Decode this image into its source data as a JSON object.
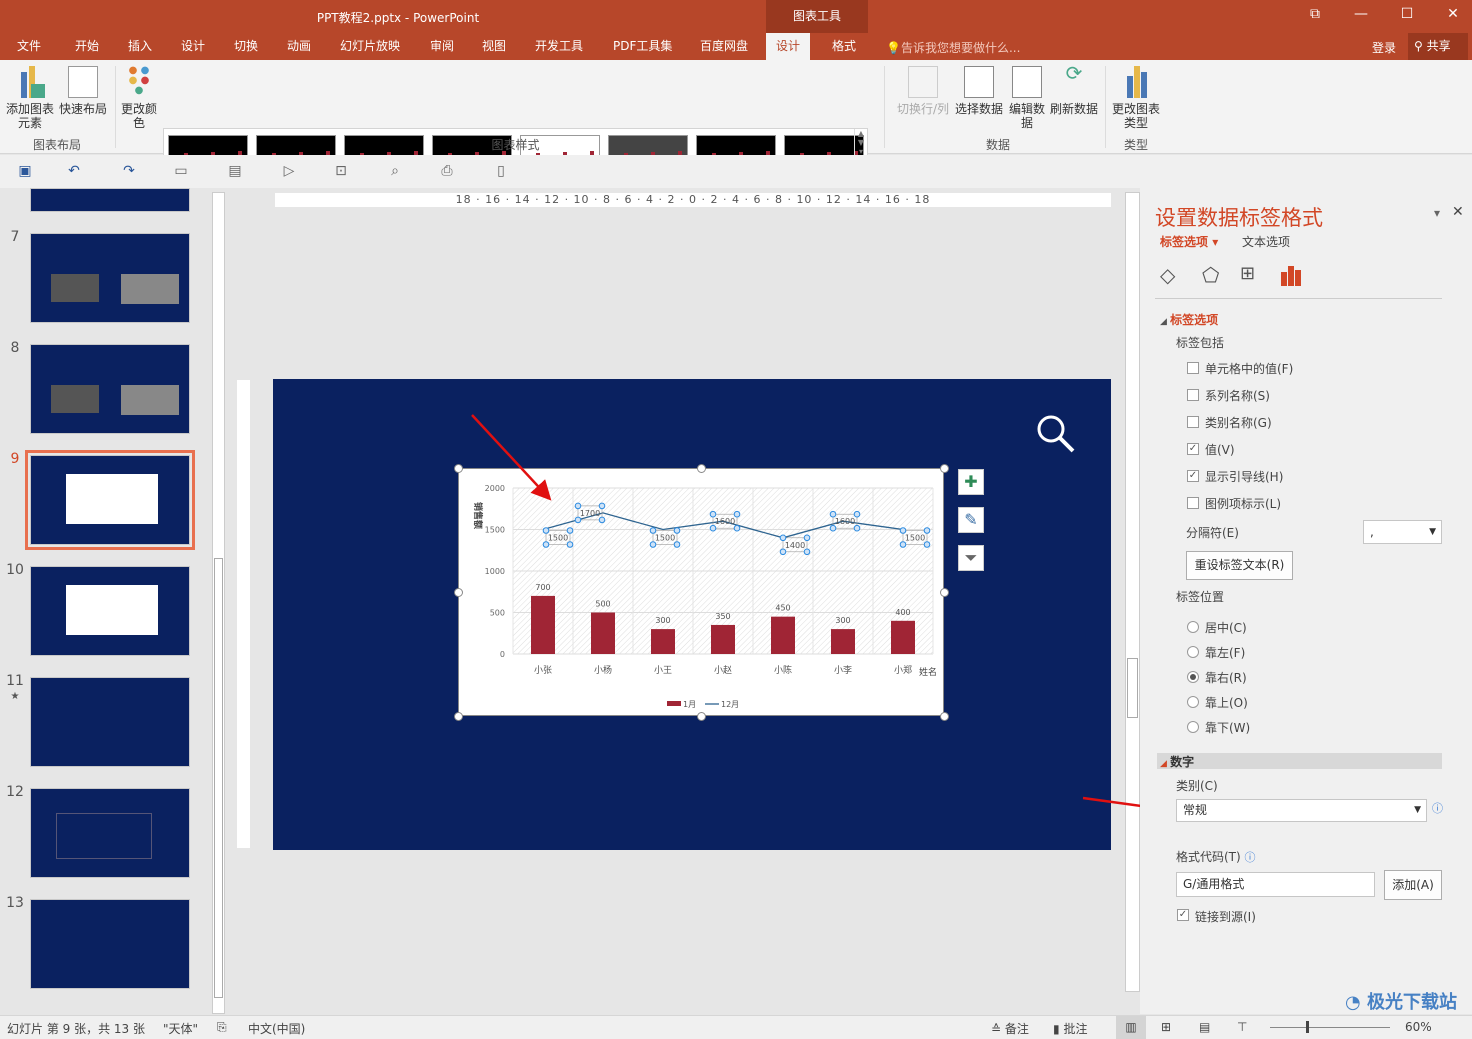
{
  "window": {
    "title": "PPT教程2.pptx - PowerPoint",
    "context_tab": "图表工具",
    "restore": "⧉",
    "minimize": "—",
    "maximize": "☐",
    "close": "✕"
  },
  "tabs": [
    {
      "label": "文件"
    },
    {
      "label": "开始"
    },
    {
      "label": "插入"
    },
    {
      "label": "设计"
    },
    {
      "label": "切换"
    },
    {
      "label": "动画"
    },
    {
      "label": "幻灯片放映"
    },
    {
      "label": "审阅"
    },
    {
      "label": "视图"
    },
    {
      "label": "开发工具"
    },
    {
      "label": "PDF工具集"
    },
    {
      "label": "百度网盘"
    },
    {
      "label": "设计",
      "active": true
    },
    {
      "label": "格式"
    }
  ],
  "tell_me": "告诉我您想要做什么...",
  "login": "登录",
  "share": "共享",
  "ribbon": {
    "add_element": "添加图表元素",
    "quick_layout": "快速布局",
    "change_color": "更改颜色",
    "switch_row_col": "切换行/列",
    "select_data": "选择数据",
    "edit_data": "编辑数据",
    "refresh_data": "刷新数据",
    "change_type": "更改图表类型",
    "groups": {
      "layout": "图表布局",
      "styles": "图表样式",
      "data": "数据",
      "type": "类型"
    }
  },
  "slides": [
    {
      "num": "7"
    },
    {
      "num": "8"
    },
    {
      "num": "9",
      "selected": true
    },
    {
      "num": "10"
    },
    {
      "num": "11",
      "star": "★"
    },
    {
      "num": "12"
    },
    {
      "num": "13"
    }
  ],
  "ruler": {
    "h": "18 · 16 · 14 · 12 · 10 · 8 · 6 · 4 · 2 · 0 · 2 · 4 · 6 · 8 · 10 · 12 · 14 · 16 · 18"
  },
  "chart_data": {
    "type": "bar+line",
    "categories": [
      "小张",
      "小杨",
      "小王",
      "小赵",
      "小陈",
      "小李",
      "小郑"
    ],
    "series": [
      {
        "name": "1月",
        "type": "bar",
        "color": "#a02535",
        "values": [
          700,
          500,
          300,
          350,
          450,
          300,
          400
        ]
      },
      {
        "name": "12月",
        "type": "line",
        "color": "#2e6490",
        "values": [
          1500,
          1700,
          1500,
          1600,
          1400,
          1600,
          1500
        ]
      }
    ],
    "ylabel": "销售额",
    "xlabel": "姓名",
    "ylim": [
      0,
      2000
    ],
    "yticks": [
      "0",
      "500",
      "1000",
      "1500",
      "2000"
    ],
    "grid": true,
    "legend": "bottom"
  },
  "pane": {
    "title": "设置数据标签格式",
    "tab_label_options": "标签选项",
    "tab_text_options": "文本选项",
    "section_label_options": "标签选项",
    "label_contains": "标签包括",
    "checkboxes": [
      {
        "label": "单元格中的值(F)",
        "checked": false
      },
      {
        "label": "系列名称(S)",
        "checked": false
      },
      {
        "label": "类别名称(G)",
        "checked": false
      },
      {
        "label": "值(V)",
        "checked": true
      },
      {
        "label": "显示引导线(H)",
        "checked": true
      },
      {
        "label": "图例项标示(L)",
        "checked": false
      }
    ],
    "separator_label": "分隔符(E)",
    "separator_value": ",",
    "reset_button": "重设标签文本(R)",
    "label_position": "标签位置",
    "positions": [
      {
        "label": "居中(C)",
        "checked": false
      },
      {
        "label": "靠左(F)",
        "checked": false
      },
      {
        "label": "靠右(R)",
        "checked": true
      },
      {
        "label": "靠上(O)",
        "checked": false
      },
      {
        "label": "靠下(W)",
        "checked": false
      }
    ],
    "section_number": "数字",
    "category_label": "类别(C)",
    "category_value": "常规",
    "format_code_label": "格式代码(T)",
    "format_code_value": "G/通用格式",
    "add_button": "添加(A)",
    "link_source": "链接到源(I)",
    "link_checked": true
  },
  "status": {
    "slide_info": "幻灯片 第 9 张，共 13 张",
    "theme": "\"天体\"",
    "language": "中文(中国)",
    "notes": "备注",
    "comments": "批注",
    "zoom": "60%"
  },
  "watermark": "极光下载站"
}
